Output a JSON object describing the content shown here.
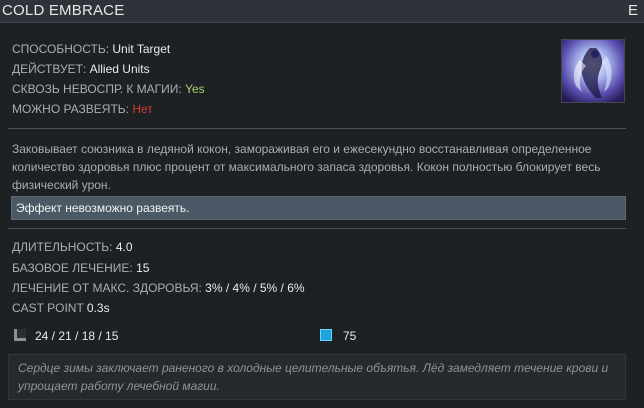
{
  "header": {
    "title": "COLD EMBRACE",
    "hotkey": "E"
  },
  "stats": {
    "ability_label": "СПОСОБНОСТЬ:",
    "ability_value": "Unit Target",
    "affects_label": "ДЕЙСТВУЕТ:",
    "affects_value": "Allied Units",
    "pierces_label": "СКВОЗЬ НЕВОСПР. К МАГИИ:",
    "pierces_value": "Yes",
    "dispellable_label": "МОЖНО РАЗВЕЯТЬ:",
    "dispellable_value": "Нет"
  },
  "description": "Заковывает союзника в ледяной кокон, замораживая его и ежесекундно восстанавливая определенное количество здоровья плюс процент от максимального запаса здоровья. Кокон полностью блокирует весь физический урон.",
  "note": "Эффект невозможно развеять.",
  "values": {
    "duration_label": "ДЛИТЕЛЬНОСТЬ:",
    "duration_value": "4.0",
    "base_heal_label": "БАЗОВОЕ ЛЕЧЕНИЕ:",
    "base_heal_value": "15",
    "max_hp_heal_label": "ЛЕЧЕНИЕ ОТ МАКС. ЗДОРОВЬЯ:",
    "max_hp_heal_value": "3% / 4% / 5% / 6%",
    "cast_point_label": "CAST POINT",
    "cast_point_value": "0.3s"
  },
  "costs": {
    "cooldown": "24 / 21 / 18 / 15",
    "mana": "75"
  },
  "lore": "Сердце зимы заключает раненого в холодные целительные объятья. Лёд замедляет течение крови и упрощает работу лечебной магии.",
  "icons": {
    "cooldown": "cooldown-icon",
    "mana": "mana-icon",
    "ability": "cold-embrace-icon"
  },
  "colors": {
    "green": "#a6d46b",
    "red": "#d43b2a",
    "note_bg": "#4b5966",
    "mana": "#1ea3d8"
  }
}
